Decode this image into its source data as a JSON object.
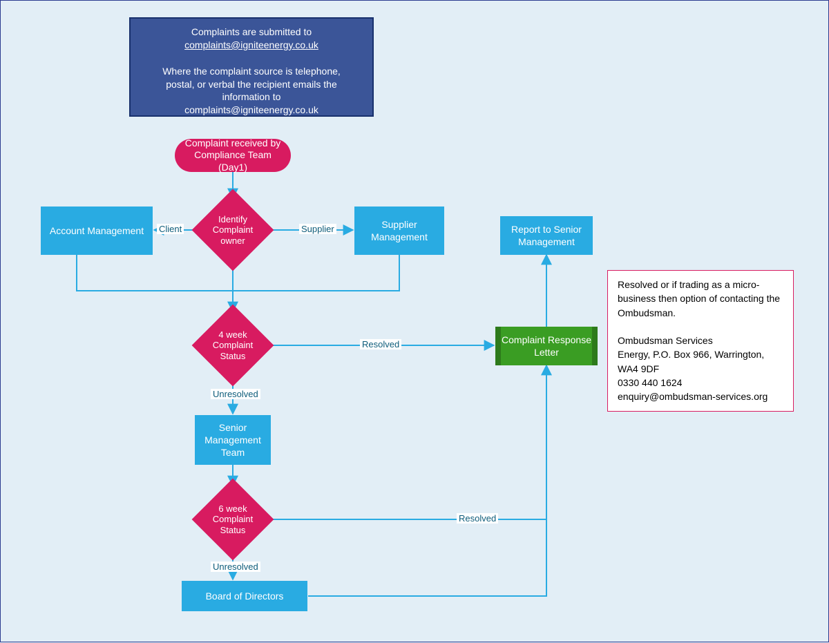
{
  "header": {
    "line1": "Complaints are submitted to",
    "email": "complaints@igniteenergy.co.uk",
    "line2a": "Where the complaint source is telephone,",
    "line2b": "postal, or verbal the recipient emails the",
    "line2c": "information to",
    "line2d": "complaints@igniteenergy.co.uk"
  },
  "nodes": {
    "start": "Complaint received by Compliance Team (Day1)",
    "identify": "Identify Complaint owner",
    "account_mgmt": "Account Management",
    "supplier_mgmt": "Supplier Management",
    "status4": "4 week Complaint Status",
    "senior_team": "Senior Management Team",
    "status6": "6 week Complaint Status",
    "board": "Board of Directors",
    "response_letter": "Complaint Response Letter",
    "report_senior": "Report to Senior Management"
  },
  "edges": {
    "client": "Client",
    "supplier": "Supplier",
    "resolved": "Resolved",
    "unresolved": "Unresolved"
  },
  "info": {
    "l1": "Resolved or if trading as a micro-business then option of contacting the Ombudsman.",
    "l2": "Ombudsman Services",
    "l3": "Energy, P.O. Box 966, Warrington, WA4 9DF",
    "l4": "0330 440 1624",
    "l5": "enquiry@ombudsman-services.org"
  }
}
